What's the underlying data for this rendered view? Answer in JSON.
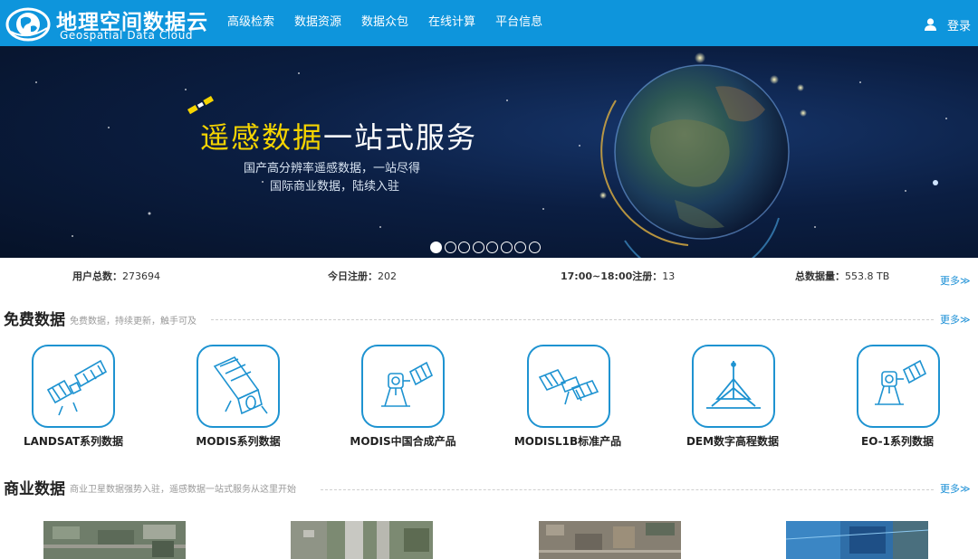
{
  "header": {
    "logo_cn": "地理空间数据云",
    "logo_en": "Geospatial Data Cloud",
    "nav": [
      "高级检索",
      "数据资源",
      "数据众包",
      "在线计算",
      "平台信息"
    ],
    "login": "登录",
    "icons": {
      "logo": "globe-logo-icon",
      "user": "user-icon"
    },
    "color": "#0e95dc"
  },
  "banner": {
    "title_highlight": "遥感数据",
    "title_rest": "一站式服务",
    "sub1": "国产高分辨率遥感数据，一站尽得",
    "sub2": "国际商业数据，陆续入驻",
    "slide_count": 8,
    "active_slide": 1
  },
  "stats": {
    "users": "用户总数：",
    "users_value": "273694",
    "today": "今日注册：",
    "today_value": "202",
    "hour": "17:00~18:00注册：",
    "hour_value": "13",
    "volume": "总数据量：",
    "volume_value": "553.8 TB",
    "more": "更多≫"
  },
  "free": {
    "title": "免费数据",
    "desc": "免费数据，持续更新，触手可及",
    "more": "更多≫",
    "items": [
      {
        "label": "LANDSAT系列数据",
        "icon": "landsat-satellite-icon"
      },
      {
        "label": "MODIS系列数据",
        "icon": "modis-satellite-icon"
      },
      {
        "label": "MODIS中国合成产品",
        "icon": "modis-china-satellite-icon"
      },
      {
        "label": "MODISL1B标准产品",
        "icon": "modis-l1b-satellite-icon"
      },
      {
        "label": "DEM数字高程数据",
        "icon": "dem-tripod-icon"
      },
      {
        "label": "EO-1系列数据",
        "icon": "eo1-satellite-icon"
      }
    ]
  },
  "commercial": {
    "title": "商业数据",
    "desc": "商业卫星数据强势入驻，遥感数据一站式服务从这里开始",
    "more": "更多≫",
    "thumbs": [
      "satellite-image-city-1",
      "satellite-image-airport",
      "satellite-image-city-2",
      "satellite-image-blue"
    ]
  },
  "colors": {
    "accent": "#1e93d1",
    "banner_title": "#f5d400"
  }
}
